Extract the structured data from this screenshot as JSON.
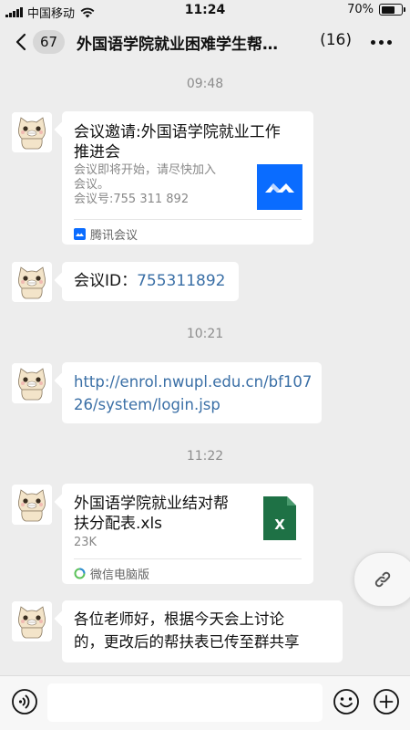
{
  "status_bar": {
    "carrier": "中国移动",
    "time": "11:24",
    "battery_text": "70%",
    "battery_level": 0.7
  },
  "nav": {
    "back_count": "67",
    "title": "外国语学院就业困难学生帮…",
    "member_count": "(16)"
  },
  "messages": {
    "ts1": "09:48",
    "meeting_card": {
      "title_line1": "会议邀请:外国语学院就业工作",
      "title_line2": "推进会",
      "desc_line1": "会议即将开始，请尽快加入",
      "desc_line2": "会议。",
      "desc_line3": "会议号:755 311 892",
      "source": "腾讯会议"
    },
    "meeting_id": {
      "label": "会议ID：",
      "value": "755311892"
    },
    "ts2": "10:21",
    "url": {
      "line1": "http://enrol.nwupl.edu.cn/bf107",
      "line2": "26/system/login.jsp"
    },
    "ts3": "11:22",
    "file_card": {
      "name_line1": "外国语学院就业结对帮",
      "name_line2": "扶分配表.xls",
      "size": "23K",
      "source": "微信电脑版",
      "file_icon_letter": "X"
    },
    "text_msg": {
      "line1": "各位老师好，根据今天会上讨论",
      "line2": "的，更改后的帮扶表已传至群共享"
    }
  },
  "colors": {
    "background": "#ededed",
    "link": "#3a6fa6",
    "tencent_meeting": "#0a6cff",
    "excel_green": "#1e7145"
  },
  "icons": [
    "back-icon",
    "more-icon",
    "tencent-meeting-icon",
    "excel-file-icon",
    "wechat-pc-icon",
    "link-icon",
    "voice-icon",
    "emoji-icon",
    "plus-icon"
  ]
}
